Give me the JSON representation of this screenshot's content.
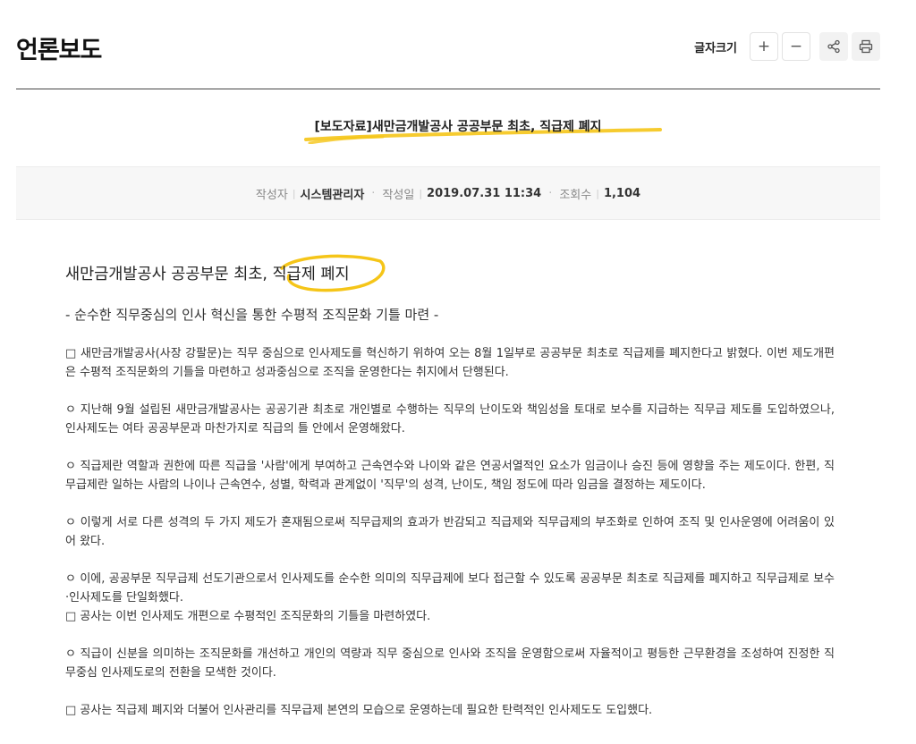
{
  "header": {
    "title": "언론보도",
    "font_size_label": "글자크기",
    "buttons": {
      "increase": "+",
      "decrease": "−"
    }
  },
  "article": {
    "title": "[보도자료]새만금개발공사 공공부문 최초, 직급제 폐지",
    "meta": {
      "author_label": "작성자",
      "author": "시스템관리자",
      "date_label": "작성일",
      "date": "2019.07.31 11:34",
      "views_label": "조회수",
      "views": "1,104"
    },
    "headline": "새만금개발공사 공공부문 최초, 직급제 폐지",
    "subheadline": "- 순수한 직무중심의 인사 혁신을 통한 수평적 조직문화 기틀 마련 -",
    "paragraphs": [
      "□ 새만금개발공사(사장 강팔문)는 직무 중심으로 인사제도를 혁신하기 위하여 오는 8월 1일부로 공공부문 최초로 직급제를 폐지한다고 밝혔다. 이번 제도개편은 수평적 조직문화의 기틀을 마련하고 성과중심으로 조직을 운영한다는 취지에서 단행된다.",
      "ㅇ 지난해 9월 설립된 새만금개발공사는 공공기관 최초로 개인별로 수행하는 직무의 난이도와 책임성을 토대로 보수를 지급하는 직무급 제도를 도입하였으나, 인사제도는 여타 공공부문과 마찬가지로 직급의 틀 안에서 운영해왔다.",
      "ㅇ 직급제란 역할과 권한에 따른 직급을 '사람'에게 부여하고 근속연수와 나이와 같은 연공서열적인 요소가 임금이나 승진 등에 영향을 주는 제도이다. 한편, 직무급제란 일하는 사람의 나이나 근속연수, 성별, 학력과 관계없이 '직무'의 성격, 난이도, 책임 정도에 따라 임금을 결정하는 제도이다.",
      "ㅇ 이렇게 서로 다른 성격의 두 가지 제도가 혼재됨으로써 직무급제의 효과가 반감되고 직급제와 직무급제의 부조화로 인하여 조직 및 인사운영에 어려움이 있어 왔다.",
      "ㅇ 이에, 공공부문 직무급제 선도기관으로서 인사제도를 순수한 의미의 직무급제에 보다 접근할 수 있도록 공공부문 최초로 직급제를 폐지하고 직무급제로 보수·인사제도를 단일화했다.",
      "□ 공사는 이번 인사제도 개편으로 수평적인 조직문화의 기틀을 마련하였다.",
      "ㅇ 직급이 신분을 의미하는 조직문화를 개선하고 개인의 역량과 직무 중심으로 인사와 조직을 운영함으로써 자율적이고 평등한 근무환경을 조성하여 진정한 직무중심 인사제도로의 전환을 모색한 것이다.",
      "□ 공사는 직급제 폐지와 더불어 인사관리를 직무급제 본연의 모습으로 운영하는데 필요한 탄력적인 인사제도도 도입했다."
    ]
  },
  "colors": {
    "highlight": "#f5c518",
    "header_rule": "#444444",
    "meta_bg": "#f7f7f7"
  },
  "icons": [
    "plus-icon",
    "minus-icon",
    "share-icon",
    "print-icon"
  ]
}
